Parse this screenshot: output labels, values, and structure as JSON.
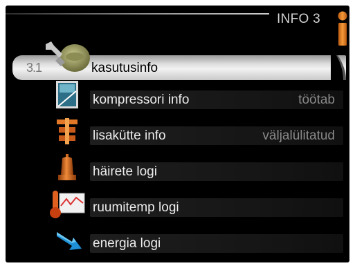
{
  "header": {
    "title": "INFO 3",
    "info_icon": "info-icon"
  },
  "menu": {
    "items": [
      {
        "number": "3.1",
        "label": "kasutusinfo",
        "value": "",
        "icon": "wrench-person-icon",
        "selected": true
      },
      {
        "label": "kompressori info",
        "value": "töötab",
        "icon": "compressor-icon"
      },
      {
        "label": "lisakütte info",
        "value": "väljalülitatud",
        "icon": "heater-icon"
      },
      {
        "label": "häirete logi",
        "value": "",
        "icon": "bell-icon"
      },
      {
        "label": "ruumitemp logi",
        "value": "",
        "icon": "thermometer-graph-icon"
      },
      {
        "label": "energia logi",
        "value": "",
        "icon": "energy-arrow-icon"
      }
    ]
  },
  "colors": {
    "background": "#000000",
    "accent_orange": "#e8821e",
    "selected_row": "#e6e6e6",
    "value_text": "#8a8a8a"
  }
}
